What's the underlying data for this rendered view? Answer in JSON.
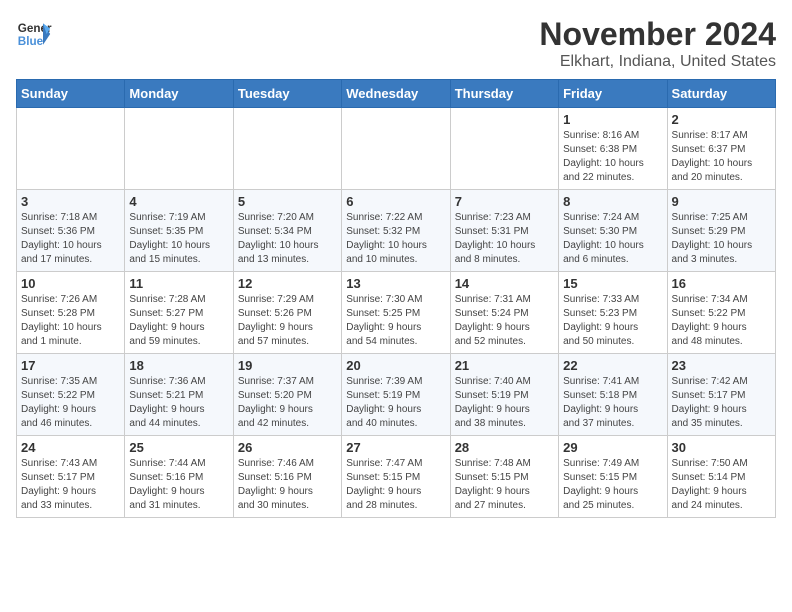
{
  "header": {
    "logo_line1": "General",
    "logo_line2": "Blue",
    "title": "November 2024",
    "subtitle": "Elkhart, Indiana, United States"
  },
  "weekdays": [
    "Sunday",
    "Monday",
    "Tuesday",
    "Wednesday",
    "Thursday",
    "Friday",
    "Saturday"
  ],
  "weeks": [
    [
      {
        "day": "",
        "info": ""
      },
      {
        "day": "",
        "info": ""
      },
      {
        "day": "",
        "info": ""
      },
      {
        "day": "",
        "info": ""
      },
      {
        "day": "",
        "info": ""
      },
      {
        "day": "1",
        "info": "Sunrise: 8:16 AM\nSunset: 6:38 PM\nDaylight: 10 hours\nand 22 minutes."
      },
      {
        "day": "2",
        "info": "Sunrise: 8:17 AM\nSunset: 6:37 PM\nDaylight: 10 hours\nand 20 minutes."
      }
    ],
    [
      {
        "day": "3",
        "info": "Sunrise: 7:18 AM\nSunset: 5:36 PM\nDaylight: 10 hours\nand 17 minutes."
      },
      {
        "day": "4",
        "info": "Sunrise: 7:19 AM\nSunset: 5:35 PM\nDaylight: 10 hours\nand 15 minutes."
      },
      {
        "day": "5",
        "info": "Sunrise: 7:20 AM\nSunset: 5:34 PM\nDaylight: 10 hours\nand 13 minutes."
      },
      {
        "day": "6",
        "info": "Sunrise: 7:22 AM\nSunset: 5:32 PM\nDaylight: 10 hours\nand 10 minutes."
      },
      {
        "day": "7",
        "info": "Sunrise: 7:23 AM\nSunset: 5:31 PM\nDaylight: 10 hours\nand 8 minutes."
      },
      {
        "day": "8",
        "info": "Sunrise: 7:24 AM\nSunset: 5:30 PM\nDaylight: 10 hours\nand 6 minutes."
      },
      {
        "day": "9",
        "info": "Sunrise: 7:25 AM\nSunset: 5:29 PM\nDaylight: 10 hours\nand 3 minutes."
      }
    ],
    [
      {
        "day": "10",
        "info": "Sunrise: 7:26 AM\nSunset: 5:28 PM\nDaylight: 10 hours\nand 1 minute."
      },
      {
        "day": "11",
        "info": "Sunrise: 7:28 AM\nSunset: 5:27 PM\nDaylight: 9 hours\nand 59 minutes."
      },
      {
        "day": "12",
        "info": "Sunrise: 7:29 AM\nSunset: 5:26 PM\nDaylight: 9 hours\nand 57 minutes."
      },
      {
        "day": "13",
        "info": "Sunrise: 7:30 AM\nSunset: 5:25 PM\nDaylight: 9 hours\nand 54 minutes."
      },
      {
        "day": "14",
        "info": "Sunrise: 7:31 AM\nSunset: 5:24 PM\nDaylight: 9 hours\nand 52 minutes."
      },
      {
        "day": "15",
        "info": "Sunrise: 7:33 AM\nSunset: 5:23 PM\nDaylight: 9 hours\nand 50 minutes."
      },
      {
        "day": "16",
        "info": "Sunrise: 7:34 AM\nSunset: 5:22 PM\nDaylight: 9 hours\nand 48 minutes."
      }
    ],
    [
      {
        "day": "17",
        "info": "Sunrise: 7:35 AM\nSunset: 5:22 PM\nDaylight: 9 hours\nand 46 minutes."
      },
      {
        "day": "18",
        "info": "Sunrise: 7:36 AM\nSunset: 5:21 PM\nDaylight: 9 hours\nand 44 minutes."
      },
      {
        "day": "19",
        "info": "Sunrise: 7:37 AM\nSunset: 5:20 PM\nDaylight: 9 hours\nand 42 minutes."
      },
      {
        "day": "20",
        "info": "Sunrise: 7:39 AM\nSunset: 5:19 PM\nDaylight: 9 hours\nand 40 minutes."
      },
      {
        "day": "21",
        "info": "Sunrise: 7:40 AM\nSunset: 5:19 PM\nDaylight: 9 hours\nand 38 minutes."
      },
      {
        "day": "22",
        "info": "Sunrise: 7:41 AM\nSunset: 5:18 PM\nDaylight: 9 hours\nand 37 minutes."
      },
      {
        "day": "23",
        "info": "Sunrise: 7:42 AM\nSunset: 5:17 PM\nDaylight: 9 hours\nand 35 minutes."
      }
    ],
    [
      {
        "day": "24",
        "info": "Sunrise: 7:43 AM\nSunset: 5:17 PM\nDaylight: 9 hours\nand 33 minutes."
      },
      {
        "day": "25",
        "info": "Sunrise: 7:44 AM\nSunset: 5:16 PM\nDaylight: 9 hours\nand 31 minutes."
      },
      {
        "day": "26",
        "info": "Sunrise: 7:46 AM\nSunset: 5:16 PM\nDaylight: 9 hours\nand 30 minutes."
      },
      {
        "day": "27",
        "info": "Sunrise: 7:47 AM\nSunset: 5:15 PM\nDaylight: 9 hours\nand 28 minutes."
      },
      {
        "day": "28",
        "info": "Sunrise: 7:48 AM\nSunset: 5:15 PM\nDaylight: 9 hours\nand 27 minutes."
      },
      {
        "day": "29",
        "info": "Sunrise: 7:49 AM\nSunset: 5:15 PM\nDaylight: 9 hours\nand 25 minutes."
      },
      {
        "day": "30",
        "info": "Sunrise: 7:50 AM\nSunset: 5:14 PM\nDaylight: 9 hours\nand 24 minutes."
      }
    ]
  ]
}
